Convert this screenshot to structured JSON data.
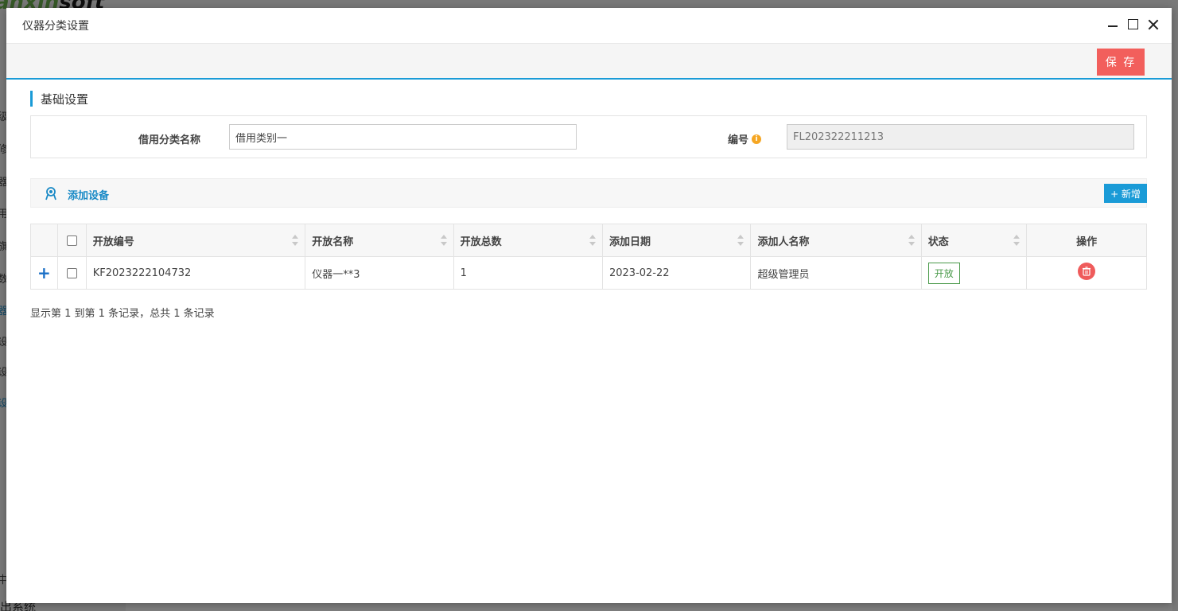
{
  "background": {
    "logo_text_green": "anxin",
    "logo_text_dark": "soft",
    "sidebar_items": [
      "级",
      "修",
      "器",
      "用",
      "旗",
      "数",
      "器",
      "设",
      "设",
      "设"
    ],
    "bottom_text": "出系统",
    "side_stub": "中"
  },
  "modal": {
    "title": "仪器分类设置"
  },
  "toolbar": {
    "save_label": "保 存"
  },
  "section": {
    "heading": "基础设置"
  },
  "form": {
    "name_label": "借用分类名称",
    "name_value": "借用类别一",
    "code_label": "编号",
    "info_glyph": "i",
    "code_value": "FL202322211213"
  },
  "add_bar": {
    "title": "添加设备",
    "new_label": "+ 新增"
  },
  "table": {
    "headers": [
      "开放编号",
      "开放名称",
      "开放总数",
      "添加日期",
      "添加人名称",
      "状态",
      "操作"
    ],
    "rows": [
      {
        "code": "KF2023222104732",
        "name": "仪器一**3",
        "total": "1",
        "date": "2023-02-22",
        "adder": "超级管理员",
        "status": "开放"
      }
    ]
  },
  "pagination": {
    "summary": "显示第 1 到第 1 条记录，总共 1 条记录"
  },
  "colors": {
    "accent": "#1a9bd7",
    "save": "#f25f5c",
    "status_green": "#4a9a4a",
    "delete_red": "#ef5b5b"
  }
}
